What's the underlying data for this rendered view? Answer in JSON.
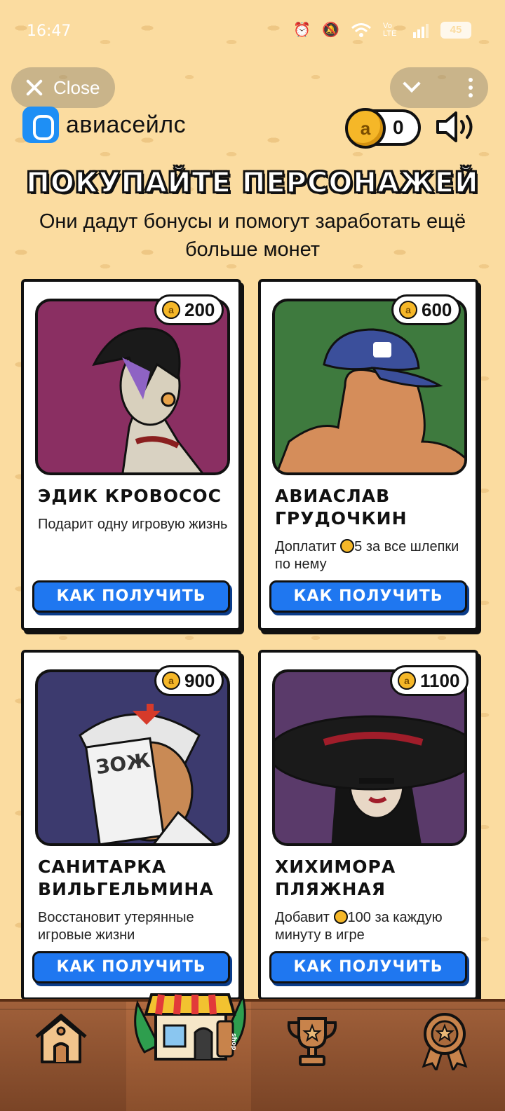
{
  "status_bar": {
    "time": "16:47",
    "network": "Vo LTE",
    "battery": "45"
  },
  "top_bar": {
    "close_label": "Close"
  },
  "header": {
    "brand_name": "авиасейлс",
    "coin_balance": "0",
    "coin_symbol": "a"
  },
  "page": {
    "title": "ПОКУПАЙТЕ ПЕРСОНАЖЕЙ",
    "subtitle": "Они дадут бонусы и помогут заработать ещё больше монет"
  },
  "cards": [
    {
      "price": "200",
      "name": "ЭДИК КРОВОСОС",
      "description": "Подарит одну игровую жизнь",
      "button": "КАК ПОЛУЧИТЬ",
      "art_color": "#8a2f62"
    },
    {
      "price": "600",
      "name": "АВИАСЛАВ ГРУДОЧКИН",
      "description_before": "Доплатит",
      "description_after": "5 за все шлепки по нему",
      "button": "КАК ПОЛУЧИТЬ",
      "art_color": "#3e7a3e"
    },
    {
      "price": "900",
      "name": "САНИТАРКА ВИЛЬГЕЛЬМИНА",
      "description": "Восстановит утерянные игровые жизни",
      "button": "КАК ПОЛУЧИТЬ",
      "art_color": "#3c3a6e"
    },
    {
      "price": "1100",
      "name": "ХИХИМОРА ПЛЯЖНАЯ",
      "description_before": "Добавит",
      "description_after": "100 за каждую минуту в игре",
      "button": "КАК ПОЛУЧИТЬ",
      "art_color": "#5a3a6a"
    }
  ],
  "bottom_nav": {
    "items": [
      "home-icon",
      "shop-icon",
      "trophy-icon",
      "medal-icon"
    ],
    "shop_sign": "shop",
    "active": "shop"
  },
  "colors": {
    "background": "#fbdca0",
    "accent_blue": "#1f77f0",
    "coin": "#f5b728",
    "wood": "#8a4f2c"
  }
}
